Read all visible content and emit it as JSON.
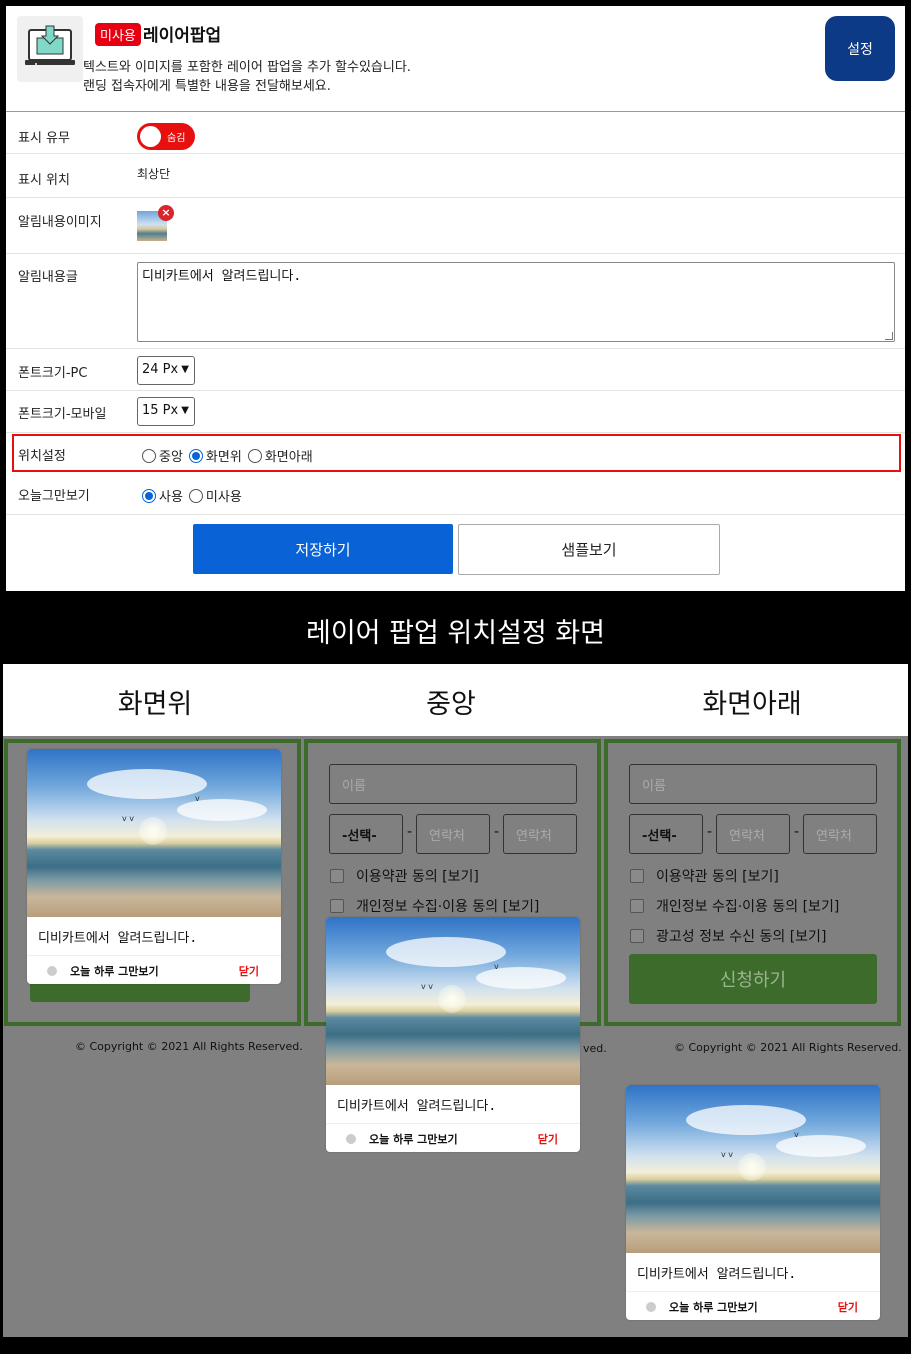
{
  "header": {
    "badge": "미사용",
    "title": "레이어팝업",
    "description": [
      "텍스트와 이미지를 포함한 레이어 팝업을 추가 할수있습니다.",
      "랜딩 접속자에게 특별한 내용을 전달해보세요."
    ],
    "settings_button": "설정"
  },
  "form": {
    "display": {
      "label": "표시 유무",
      "toggle_text": "숨김"
    },
    "position_show": {
      "label": "표시 위치",
      "value": "최상단"
    },
    "image": {
      "label": "알림내용이미지"
    },
    "content": {
      "label": "알림내용글",
      "value": "디비카트에서 알려드립니다."
    },
    "font_pc": {
      "label": "폰트크기-PC",
      "value": "24 Px"
    },
    "font_mobile": {
      "label": "폰트크기-모바일",
      "value": "15 Px"
    },
    "position": {
      "label": "위치설정",
      "options": [
        "중앙",
        "화면위",
        "화면아래"
      ],
      "selected": "화면위"
    },
    "today": {
      "label": "오늘그만보기",
      "options": [
        "사용",
        "미사용"
      ],
      "selected": "사용"
    }
  },
  "buttons": {
    "save": "저장하기",
    "sample": "샘플보기"
  },
  "banner": "레이어 팝업 위치설정 화면",
  "preview": {
    "columns": [
      "화면위",
      "중앙",
      "화면아래"
    ],
    "form": {
      "name_placeholder": "이름",
      "select": "-선택-",
      "contact_placeholder": "연락처",
      "dash": "-",
      "checks": [
        "이용약관 동의 [보기]",
        "개인정보 수집·이용 동의 [보기]",
        "광고성 정보 수신 동의 [보기]"
      ],
      "apply": "신청하기"
    },
    "copyright": "© Copyright © 2021 All Rights Reserved.",
    "popup": {
      "text": "디비카트에서 알려드립니다.",
      "no_today": "오늘 하루 그만보기",
      "close": "닫기"
    }
  },
  "colors": {
    "accent": "#0a63d6",
    "danger": "#e8100f",
    "brand_dark": "#0c3a86",
    "frame_green": "#3d6b2c"
  }
}
